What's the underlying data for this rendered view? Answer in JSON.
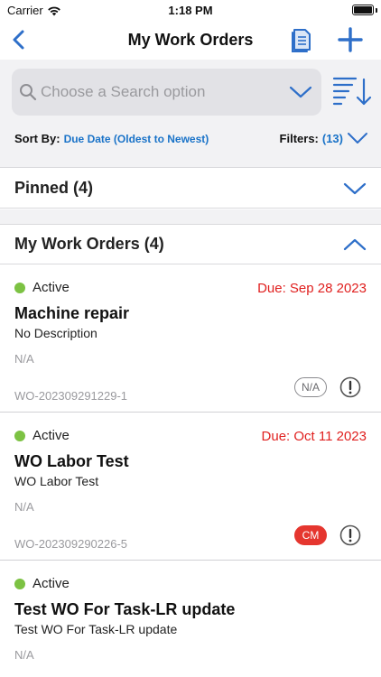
{
  "status_bar": {
    "carrier": "Carrier",
    "time": "1:18 PM"
  },
  "nav": {
    "title": "My Work Orders",
    "back_icon": "chevron-left-icon",
    "doc_icon": "document-icon",
    "add_icon": "plus-icon"
  },
  "search": {
    "placeholder": "Choose a Search option",
    "value": ""
  },
  "sort": {
    "label": "Sort By:",
    "value": "Due Date (Oldest to Newest)"
  },
  "filters": {
    "label": "Filters:",
    "count": "(13)"
  },
  "sections": {
    "pinned": {
      "label": "Pinned (4)",
      "expanded": false
    },
    "mine": {
      "label": "My Work Orders (4)",
      "expanded": true
    }
  },
  "work_orders": [
    {
      "status": "Active",
      "due": "Due: Sep 28 2023",
      "title": "Machine repair",
      "description": "No Description",
      "na": "N/A",
      "id": "WO-202309291229-1",
      "badge": "N/A",
      "badge_style": "outline"
    },
    {
      "status": "Active",
      "due": "Due: Oct 11 2023",
      "title": "WO Labor Test",
      "description": "WO Labor Test",
      "na": "N/A",
      "id": "WO-202309290226-5",
      "badge": "CM",
      "badge_style": "solid"
    },
    {
      "status": "Active",
      "due": "",
      "title": "Test WO For Task-LR update",
      "description": "Test WO For Task-LR update",
      "na": "N/A",
      "id": "",
      "badge": "",
      "badge_style": ""
    }
  ],
  "colors": {
    "accent": "#2e6fc9",
    "link": "#1a73c8",
    "due": "#e0201f",
    "active": "#7cc243",
    "cm_badge": "#e5362f"
  }
}
